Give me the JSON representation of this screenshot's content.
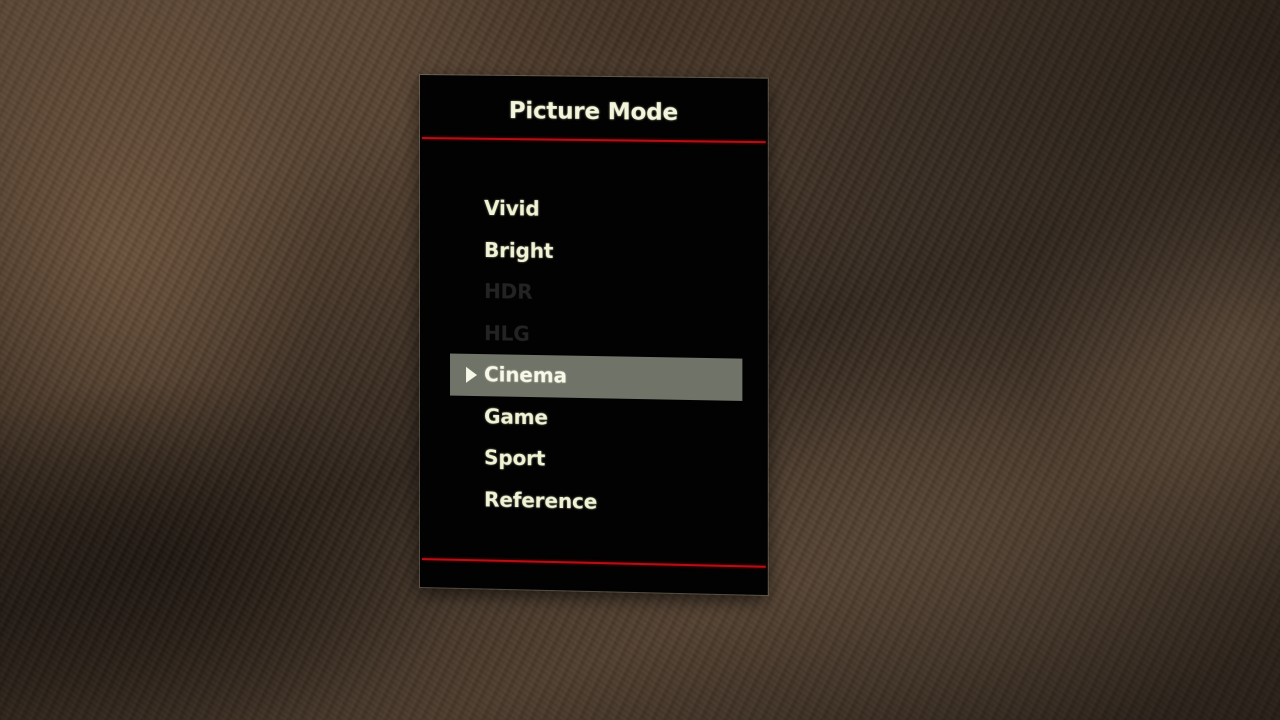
{
  "menu": {
    "title": "Picture Mode",
    "items": [
      {
        "label": "Vivid"
      },
      {
        "label": "Bright"
      },
      {
        "label": "HDR"
      },
      {
        "label": "HLG"
      },
      {
        "label": "Cinema"
      },
      {
        "label": "Game"
      },
      {
        "label": "Sport"
      },
      {
        "label": "Reference"
      }
    ],
    "selected_label": "Cinema",
    "disabled_labels": [
      "HDR",
      "HLG"
    ]
  },
  "colors": {
    "panel_bg": "#020202",
    "divider": "#b80d14",
    "text": "#f1f3d6",
    "disabled_text": "#232323",
    "selection_bg": "#6f7368"
  }
}
